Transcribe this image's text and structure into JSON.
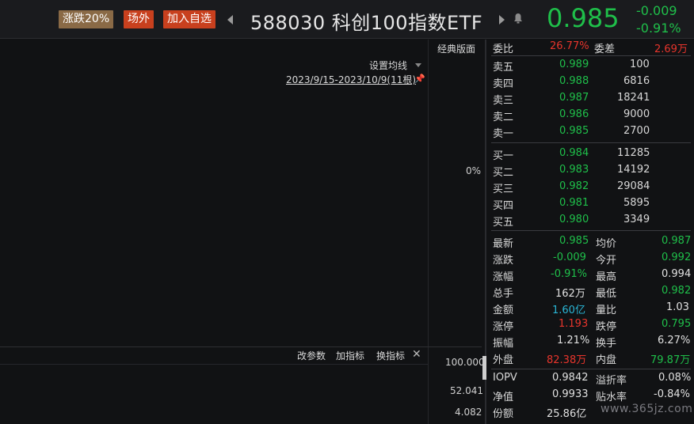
{
  "header": {
    "tag_limit": "涨跌20%",
    "tag_otc": "场外",
    "tag_add": "加入自选",
    "title": "588030 科创100指数ETF",
    "price": "0.985",
    "change": "-0.009",
    "change_pct": "-0.91%",
    "colors": {
      "down": "#1fbf4a",
      "up": "#e8352c",
      "tag_brown": "#8a6a46",
      "tag_red": "#c8401e"
    }
  },
  "chart": {
    "classic_layout": "经典版面",
    "ma_setting": "设置均线",
    "date_range": "2023/9/15-2023/10/9(11根)",
    "zero_pct": "0%",
    "sub_buttons": {
      "params": "改参数",
      "add_indicator": "加指标",
      "switch_indicator": "换指标"
    },
    "volume_axis": [
      "100.000",
      "52.041",
      "4.082"
    ]
  },
  "quote": {
    "ratio": {
      "label": "委比",
      "value": "26.77%"
    },
    "diff": {
      "label": "委差",
      "value": "2.69万"
    },
    "asks": [
      {
        "label": "卖五",
        "price": "0.989",
        "vol": "100"
      },
      {
        "label": "卖四",
        "price": "0.988",
        "vol": "6816"
      },
      {
        "label": "卖三",
        "price": "0.987",
        "vol": "18241"
      },
      {
        "label": "卖二",
        "price": "0.986",
        "vol": "9000"
      },
      {
        "label": "卖一",
        "price": "0.985",
        "vol": "2700"
      }
    ],
    "bids": [
      {
        "label": "买一",
        "price": "0.984",
        "vol": "11285"
      },
      {
        "label": "买二",
        "price": "0.983",
        "vol": "14192"
      },
      {
        "label": "买三",
        "price": "0.982",
        "vol": "29084"
      },
      {
        "label": "买四",
        "price": "0.981",
        "vol": "5895"
      },
      {
        "label": "买五",
        "price": "0.980",
        "vol": "3349"
      }
    ],
    "stats": {
      "latest": {
        "label": "最新",
        "value": "0.985"
      },
      "avg": {
        "label": "均价",
        "value": "0.987"
      },
      "change": {
        "label": "涨跌",
        "value": "-0.009"
      },
      "open": {
        "label": "今开",
        "value": "0.992"
      },
      "pct": {
        "label": "涨幅",
        "value": "-0.91%"
      },
      "high": {
        "label": "最高",
        "value": "0.994"
      },
      "volume": {
        "label": "总手",
        "value": "162万"
      },
      "low": {
        "label": "最低",
        "value": "0.982"
      },
      "amount": {
        "label": "金额",
        "value": "1.60亿"
      },
      "vol_ratio": {
        "label": "量比",
        "value": "1.03"
      },
      "limit_up": {
        "label": "涨停",
        "value": "1.193"
      },
      "limit_down": {
        "label": "跌停",
        "value": "0.795"
      },
      "amplitude": {
        "label": "振幅",
        "value": "1.21%"
      },
      "turnover": {
        "label": "换手",
        "value": "6.27%"
      },
      "outer": {
        "label": "外盘",
        "value": "82.38万"
      },
      "inner": {
        "label": "内盘",
        "value": "79.87万"
      },
      "iopv": {
        "label": "IOPV",
        "value": "0.9842"
      },
      "premium": {
        "label": "溢折率",
        "value": "0.08%"
      },
      "nav": {
        "label": "净值",
        "value": "0.9933"
      },
      "discount": {
        "label": "贴水率",
        "value": "-0.84%"
      },
      "shares": {
        "label": "份额",
        "value": "25.86亿"
      }
    },
    "watermark": "www.365jz.com"
  }
}
